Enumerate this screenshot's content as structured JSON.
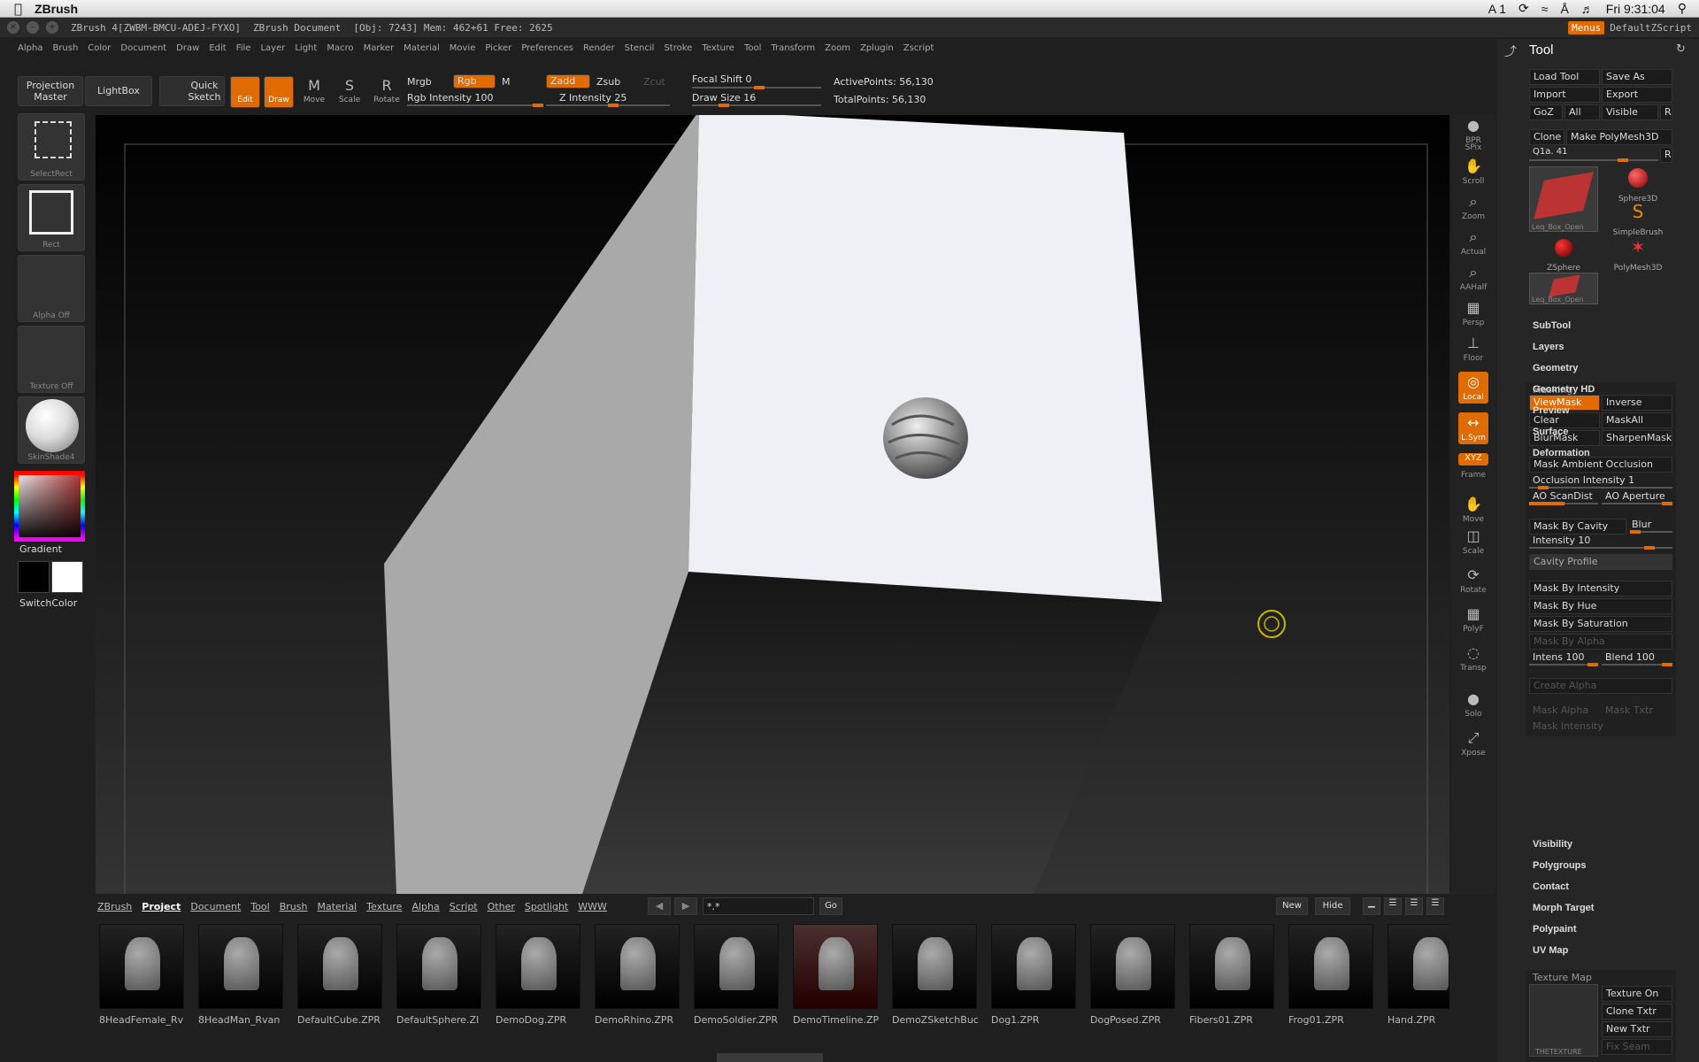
{
  "macbar": {
    "app_name": "ZBrush",
    "time": "Fri 9:31:04",
    "adobe": "1"
  },
  "titlebar": {
    "title": "ZBrush 4[ZWBM-BMCU-ADEJ-FYXO]",
    "doc": "ZBrush Document",
    "stats": "[Obj: 7243] Mem: 462+61 Free: 2625",
    "menus": "Menus",
    "script": "DefaultZScript"
  },
  "menu": [
    "Alpha",
    "Brush",
    "Color",
    "Document",
    "Draw",
    "Edit",
    "File",
    "Layer",
    "Light",
    "Macro",
    "Marker",
    "Material",
    "Movie",
    "Picker",
    "Preferences",
    "Render",
    "Stencil",
    "Stroke",
    "Texture",
    "Tool",
    "Transform",
    "Zoom",
    "Zplugin",
    "Zscript"
  ],
  "toolbar": {
    "projection_master": "Projection Master",
    "lightbox": "LightBox",
    "quick_sketch": "Quick Sketch",
    "edit": "Edit",
    "draw": "Draw",
    "move": "Move",
    "scale": "Scale",
    "rotate": "Rotate",
    "mrgb": "Mrgb",
    "rgb": "Rgb",
    "m": "M",
    "rgb_intensity": "Rgb Intensity 100",
    "zadd": "Zadd",
    "zsub": "Zsub",
    "zcut": "Zcut",
    "z_intensity": "Z Intensity 25",
    "focal_shift": "Focal Shift 0",
    "draw_size": "Draw Size 16",
    "active_points": "ActivePoints: 56,130",
    "total_points": "TotalPoints: 56,130"
  },
  "lefttray": {
    "selectrect": "SelectRect",
    "rect": "Rect",
    "alpha": "Alpha  Off",
    "texture": "Texture  Off",
    "material": "SkinShade4",
    "gradient": "Gradient",
    "switchcolor": "SwitchColor"
  },
  "shelf": [
    "BPR",
    "SPix",
    "Scroll",
    "Zoom",
    "Actual",
    "AAHalf",
    "Persp",
    "Floor",
    "Local",
    "L.Sym",
    "Frame",
    "Move",
    "Scale",
    "Rotate",
    "PolyF",
    "Transp",
    "Solo",
    "Xpose"
  ],
  "shelf_xyz": "XYZ",
  "palette": {
    "title": "Tool",
    "buttons": {
      "load_tool": "Load Tool",
      "save_as": "Save As",
      "import": "Import",
      "export": "Export",
      "goz": "GoZ",
      "all": "All",
      "visible": "Visible",
      "r": "R",
      "clone": "Clone",
      "make_polymesh": "Make PolyMesh3D",
      "slider": "Q1a. 41"
    },
    "tools": {
      "sphere3d": "Sphere3D",
      "simplebrush": "SimpleBrush",
      "zsphere": "ZSphere",
      "polymesh3d": "PolyMesh3D",
      "leq1": "Leq_Box_Open",
      "leq2": "Leq_Box_Open"
    },
    "sections_top": [
      "SubTool",
      "Layers",
      "Geometry",
      "Geometry HD",
      "Preview",
      "Surface",
      "Deformation"
    ],
    "masking": {
      "title": "Masking",
      "viewmask": "ViewMask",
      "inverse": "Inverse",
      "clear": "Clear",
      "maskall": "MaskAll",
      "blurmask": "BlurMask",
      "sharpenmask": "SharpenMask",
      "mao": "Mask Ambient Occlusion",
      "occlusion": "Occlusion Intensity 1",
      "ao_scandist": "AO ScanDist",
      "ao_aperture": "AO Aperture",
      "mask_by_cavity": "Mask By Cavity",
      "blur": "Blur",
      "intensity": "Intensity 10",
      "cavity_profile": "Cavity Profile",
      "mask_by_intensity": "Mask By Intensity",
      "mask_by_hue": "Mask By Hue",
      "mask_by_saturation": "Mask By Saturation",
      "mask_by_alpha": "Mask By Alpha",
      "intens": "Intens 100",
      "blend": "Blend 100",
      "create_alpha": "Create Alpha",
      "mask_alpha": "Mask Alpha",
      "mask_txtr": "Mask Txtr",
      "mask_intensity": "Mask Intensity"
    },
    "sections_bottom": [
      "Visibility",
      "Polygroups",
      "Contact",
      "Morph Target",
      "Polypaint",
      "UV Map"
    ],
    "texture_map": {
      "title": "Texture Map",
      "texture_on": "Texture On",
      "clone_txtr": "Clone Txtr",
      "new_txtr": "New Txtr",
      "fix_seam": "Fix Seam",
      "thumb": "THETEXTURE"
    }
  },
  "bottom": {
    "tabs": [
      "ZBrush",
      "Project",
      "Document",
      "Tool",
      "Brush",
      "Material",
      "Texture",
      "Alpha",
      "Script",
      "Other",
      "Spotlight",
      "WWW"
    ],
    "active_tab": "Project",
    "search": "*.*",
    "go": "Go",
    "new": "New",
    "hide": "Hide",
    "files": [
      "8HeadFemale_Rv",
      "8HeadMan_Rvan",
      "DefaultCube.ZPR",
      "DefaultSphere.ZI",
      "DemoDog.ZPR",
      "DemoRhino.ZPR",
      "DemoSoldier.ZPR",
      "DemoTimeline.ZP",
      "DemoZSketchBuc",
      "Dog1.ZPR",
      "DogPosed.ZPR",
      "Fibers01.ZPR",
      "Frog01.ZPR",
      "Hand.ZPR"
    ]
  }
}
